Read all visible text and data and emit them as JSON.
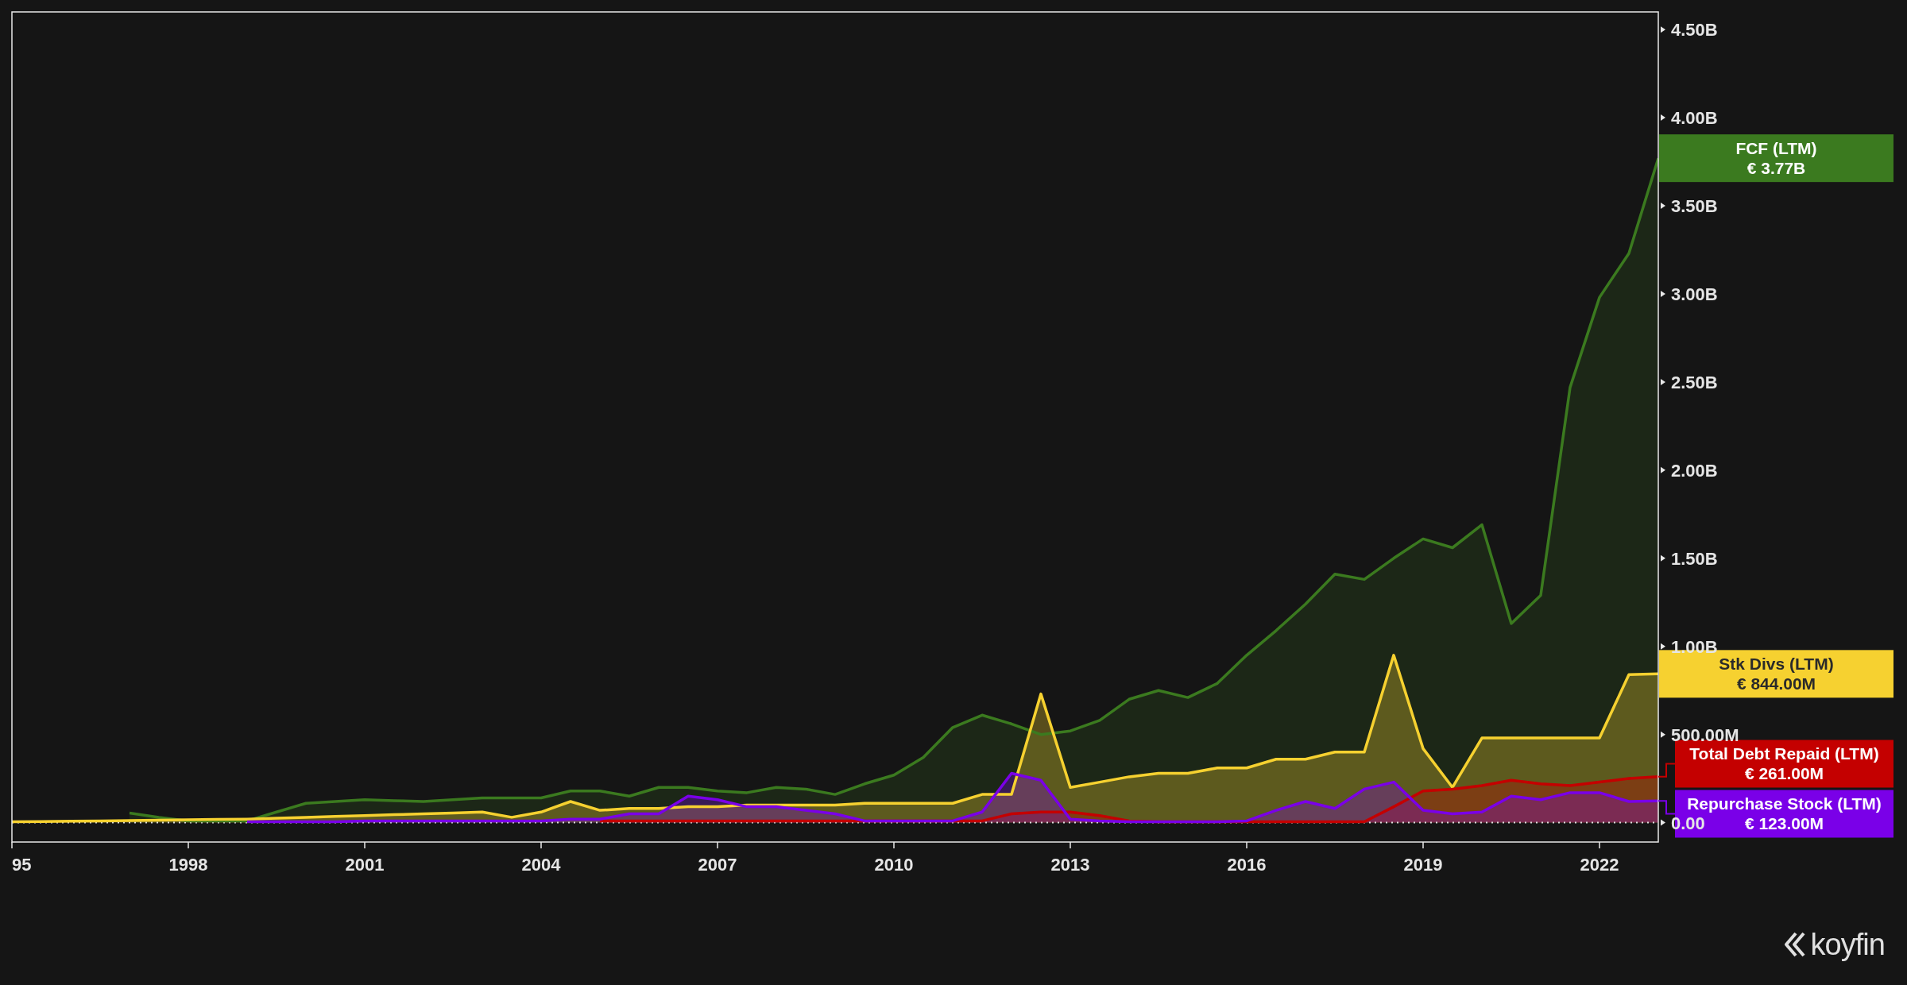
{
  "chart": {
    "chart_data": {
      "type": "area",
      "x": [
        1995,
        1995.5,
        1996,
        1996.5,
        1997,
        1997.5,
        1998,
        1998.5,
        1999,
        1999.5,
        2000,
        2000.5,
        2001,
        2001.5,
        2002,
        2002.5,
        2003,
        2003.5,
        2004,
        2004.5,
        2005,
        2005.5,
        2006,
        2006.5,
        2007,
        2007.5,
        2008,
        2008.5,
        2009,
        2009.5,
        2010,
        2010.5,
        2011,
        2011.5,
        2012,
        2012.5,
        2013,
        2013.5,
        2014,
        2014.5,
        2015,
        2015.5,
        2016,
        2016.5,
        2017,
        2017.5,
        2018,
        2018.5,
        2019,
        2019.5,
        2020,
        2020.5,
        2021,
        2021.5,
        2022,
        2022.5,
        2023
      ],
      "series": [
        {
          "name": "FCF (LTM)",
          "color": "#3b7a1f",
          "values": [
            null,
            null,
            null,
            null,
            55000000,
            30000000,
            10000000,
            10000000,
            10000000,
            60000000,
            110000000,
            120000000,
            130000000,
            125000000,
            120000000,
            130000000,
            140000000,
            140000000,
            140000000,
            180000000,
            180000000,
            150000000,
            200000000,
            200000000,
            180000000,
            170000000,
            200000000,
            190000000,
            160000000,
            220000000,
            270000000,
            370000000,
            540000000,
            610000000,
            560000000,
            500000000,
            520000000,
            580000000,
            700000000,
            750000000,
            710000000,
            790000000,
            950000000,
            1090000000,
            1240000000,
            1410000000,
            1380000000,
            1500000000,
            1610000000,
            1560000000,
            1690000000,
            1130000000,
            1290000000,
            2470000000,
            2980000000,
            3230000000,
            3770000000
          ]
        },
        {
          "name": "Stk Divs (LTM)",
          "color": "#f6d130",
          "values": [
            5000000,
            6000000,
            8000000,
            10000000,
            12000000,
            14000000,
            16000000,
            18000000,
            20000000,
            25000000,
            30000000,
            35000000,
            40000000,
            45000000,
            50000000,
            55000000,
            60000000,
            30000000,
            60000000,
            120000000,
            70000000,
            80000000,
            80000000,
            90000000,
            90000000,
            100000000,
            100000000,
            100000000,
            100000000,
            110000000,
            110000000,
            110000000,
            110000000,
            160000000,
            160000000,
            730000000,
            200000000,
            230000000,
            260000000,
            280000000,
            280000000,
            310000000,
            310000000,
            360000000,
            360000000,
            400000000,
            400000000,
            950000000,
            420000000,
            200000000,
            480000000,
            480000000,
            480000000,
            480000000,
            480000000,
            840000000,
            844000000
          ]
        },
        {
          "name": "Total Debt Repaid (LTM)",
          "color": "#c40000",
          "values": [
            null,
            null,
            null,
            null,
            null,
            null,
            null,
            null,
            null,
            null,
            null,
            null,
            null,
            null,
            null,
            null,
            null,
            null,
            null,
            null,
            10000000,
            10000000,
            10000000,
            10000000,
            10000000,
            10000000,
            10000000,
            10000000,
            10000000,
            10000000,
            10000000,
            10000000,
            10000000,
            10000000,
            50000000,
            60000000,
            60000000,
            40000000,
            10000000,
            5000000,
            5000000,
            5000000,
            5000000,
            5000000,
            5000000,
            5000000,
            5000000,
            90000000,
            180000000,
            190000000,
            210000000,
            240000000,
            220000000,
            210000000,
            230000000,
            250000000,
            261000000
          ]
        },
        {
          "name": "Repurchase Stock (LTM)",
          "color": "#7a00e8",
          "values": [
            null,
            null,
            null,
            null,
            null,
            null,
            null,
            null,
            5000000,
            5000000,
            5000000,
            5000000,
            10000000,
            10000000,
            10000000,
            10000000,
            10000000,
            10000000,
            10000000,
            20000000,
            20000000,
            50000000,
            50000000,
            150000000,
            130000000,
            90000000,
            90000000,
            70000000,
            50000000,
            10000000,
            10000000,
            10000000,
            10000000,
            60000000,
            280000000,
            240000000,
            20000000,
            10000000,
            5000000,
            5000000,
            5000000,
            5000000,
            10000000,
            70000000,
            120000000,
            80000000,
            190000000,
            230000000,
            70000000,
            50000000,
            60000000,
            150000000,
            130000000,
            170000000,
            170000000,
            120000000,
            123000000
          ]
        }
      ],
      "xlim": [
        1995,
        2023
      ],
      "ylim": [
        -110000000,
        4600000000
      ],
      "xticks": [
        {
          "value": 1995,
          "label": "95"
        },
        {
          "value": 1998,
          "label": "1998"
        },
        {
          "value": 2001,
          "label": "2001"
        },
        {
          "value": 2004,
          "label": "2004"
        },
        {
          "value": 2007,
          "label": "2007"
        },
        {
          "value": 2010,
          "label": "2010"
        },
        {
          "value": 2013,
          "label": "2013"
        },
        {
          "value": 2016,
          "label": "2016"
        },
        {
          "value": 2019,
          "label": "2019"
        },
        {
          "value": 2022,
          "label": "2022"
        }
      ],
      "yticks": [
        {
          "value": 0,
          "label": "0.00"
        },
        {
          "value": 500000000,
          "label": "500.00M"
        },
        {
          "value": 1000000000,
          "label": "1.00B"
        },
        {
          "value": 1500000000,
          "label": "1.50B"
        },
        {
          "value": 2000000000,
          "label": "2.00B"
        },
        {
          "value": 2500000000,
          "label": "2.50B"
        },
        {
          "value": 3000000000,
          "label": "3.00B"
        },
        {
          "value": 3500000000,
          "label": "3.50B"
        },
        {
          "value": 4000000000,
          "label": "4.00B"
        },
        {
          "value": 4500000000,
          "label": "4.50B"
        }
      ]
    },
    "end_labels": [
      "€ 3.77B",
      "€ 844.00M",
      "€ 261.00M",
      "€ 123.00M"
    ]
  },
  "brand": "koyfin"
}
